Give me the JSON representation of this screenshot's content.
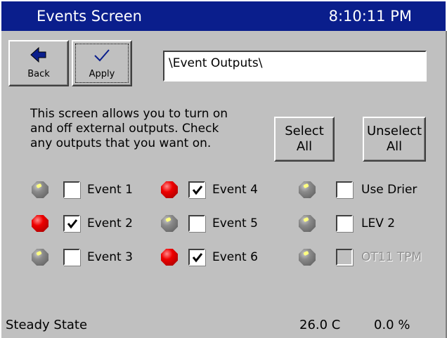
{
  "header": {
    "title": "Events Screen",
    "time": "8:10:11 PM"
  },
  "toolbar": {
    "back_label": "Back",
    "apply_label": "Apply"
  },
  "path": "\\Event Outputs\\",
  "description": {
    "line1": "This screen allows you to turn on",
    "line2": "and off external outputs.  Check",
    "line3": "any outputs that you want on."
  },
  "select_all": {
    "line1": "Select",
    "line2": "All"
  },
  "unselect_all": {
    "line1": "Unselect",
    "line2": "All"
  },
  "outputs": [
    {
      "label": "Event 1",
      "checked": false,
      "active": false,
      "enabled": true
    },
    {
      "label": "Event 2",
      "checked": true,
      "active": true,
      "enabled": true
    },
    {
      "label": "Event 3",
      "checked": false,
      "active": false,
      "enabled": true
    },
    {
      "label": "Event 4",
      "checked": true,
      "active": true,
      "enabled": true
    },
    {
      "label": "Event 5",
      "checked": false,
      "active": false,
      "enabled": true
    },
    {
      "label": "Event 6",
      "checked": true,
      "active": true,
      "enabled": true
    },
    {
      "label": "Use Drier",
      "checked": false,
      "active": false,
      "enabled": true
    },
    {
      "label": "LEV 2",
      "checked": false,
      "active": false,
      "enabled": true
    },
    {
      "label": "OT11 TPM",
      "checked": false,
      "active": false,
      "enabled": false
    }
  ],
  "status": {
    "state": "Steady State",
    "temperature": "26.0 C",
    "percent": "0.0 %"
  },
  "colors": {
    "title_bar": "#0a1e8c",
    "background": "#c0c0c0",
    "led_on": "#ee0000",
    "led_off": "#8a8a8a"
  }
}
